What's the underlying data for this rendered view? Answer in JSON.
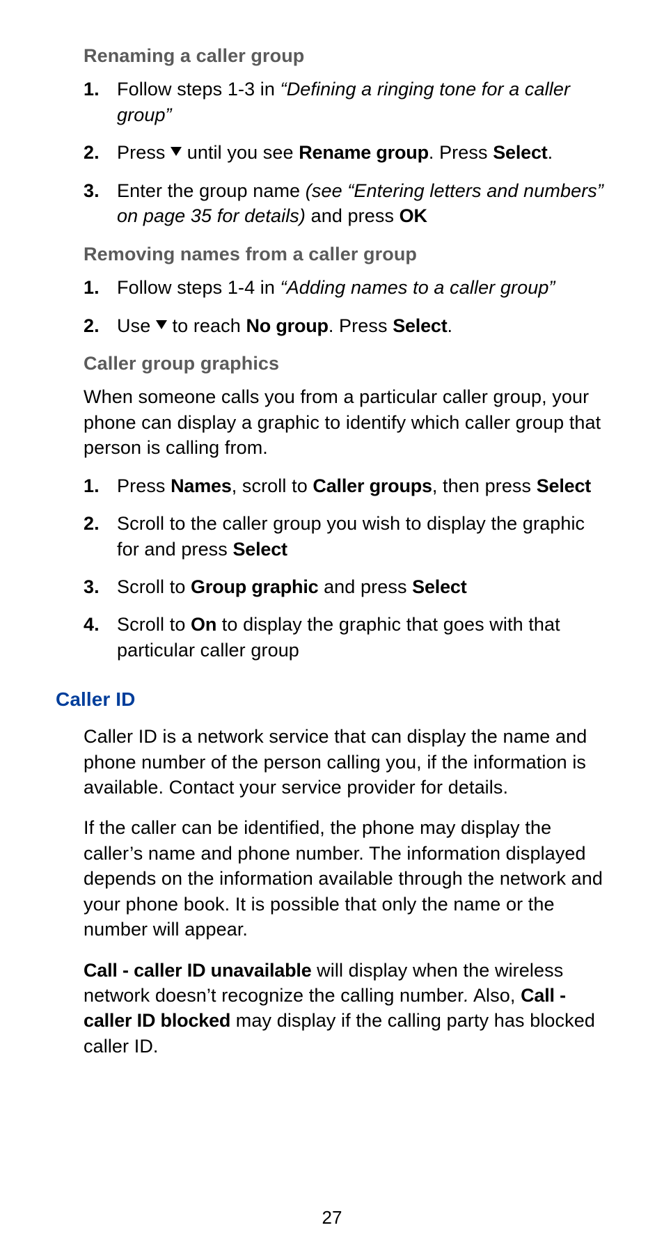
{
  "page_number": "27",
  "section_rename": {
    "title": "Renaming a caller group",
    "step1": {
      "num": "1.",
      "pre": "Follow steps 1-3 in ",
      "ital": "“Defining a ringing tone for a caller group”"
    },
    "step2": {
      "num": "2.",
      "t1": "Press ",
      "t2": " until you see ",
      "b1": "Rename group",
      "t3": ". Press ",
      "b2": "Select",
      "t4": "."
    },
    "step3": {
      "num": "3.",
      "t1": "Enter the group name ",
      "ital": "(see “Entering letters and numbers” on page 35 for details)",
      "t2": " and press ",
      "b1": "OK"
    }
  },
  "section_remove": {
    "title": "Removing names from a caller group",
    "step1": {
      "num": "1.",
      "pre": "Follow steps 1-4 in ",
      "ital": "“Adding names to a caller group”"
    },
    "step2": {
      "num": "2.",
      "t1": "Use ",
      "t2": " to reach ",
      "b1": "No group",
      "t3": ". Press ",
      "b2": "Select",
      "t4": "."
    }
  },
  "section_graphics": {
    "title": "Caller group graphics",
    "intro": "When someone calls you from a particular caller group, your phone can display a graphic to identify which caller group that person is calling from.",
    "step1": {
      "num": "1.",
      "t1": "Press ",
      "b1": "Names",
      "t2": ", scroll to ",
      "b2": "Caller groups",
      "t3": ", then press ",
      "b3": "Select"
    },
    "step2": {
      "num": "2.",
      "t1": "Scroll to the caller group you wish to display the graphic for and press ",
      "b1": "Select"
    },
    "step3": {
      "num": "3.",
      "t1": "Scroll to ",
      "b1": "Group graphic",
      "t2": " and press ",
      "b2": "Select"
    },
    "step4": {
      "num": "4.",
      "t1": "Scroll to ",
      "b1": "On",
      "t2": " to display the graphic that goes with that particular caller group"
    }
  },
  "section_callerid": {
    "title": "Caller ID",
    "p1": "Caller ID is a network service that can display the name and phone number of the person calling you, if the information is available. Contact your service provider for details.",
    "p2": "If the caller can be identified, the phone may display the caller’s name and phone number. The information displayed depends on the information available through the network and your phone book. It is possible that only the name or the number will appear.",
    "p3": {
      "b1": "Call - caller ID unavailable",
      "t1": " will display when the wireless network doesn’t recognize the calling number",
      "i1": ".",
      "t1b": " Also, ",
      "b2": "Call - caller ID blocked",
      "t2": " may display if the calling party has blocked caller ID."
    }
  }
}
